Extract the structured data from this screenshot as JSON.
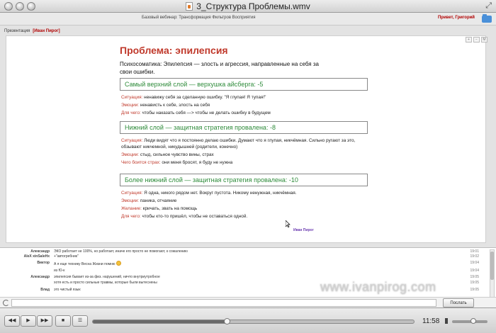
{
  "window": {
    "title": "3_Структура Проблемы.wmv",
    "resize_glyph": "⤢"
  },
  "webinar": {
    "title": "Базовый вебинар: Трансформация Фильтров Восприятия",
    "greeting": "Привет, Григорий"
  },
  "presentation": {
    "label": "Презентация",
    "presenter": "[Иван Пирог]",
    "zoom_buttons": [
      "+",
      "−",
      "M"
    ]
  },
  "slide": {
    "title": "Проблема: эпилепсия",
    "intro": "Психосоматика: Эпилепсия — злость и агрессия, направленные на себя за свои ошибки.",
    "sections": [
      {
        "heading": "Самый верхний слой — верхушка айсберга: -5",
        "lines": [
          {
            "label": "Ситуация:",
            "text": " ненавижу себя за сделанную ошибку. \"Я глупая! Я тупая!\""
          },
          {
            "label": "Эмоции:",
            "text": " ненависть к себе, злость на себя"
          },
          {
            "label": "Для чего:",
            "text": " чтобы наказать себя —> чтобы не делать ошибку в будущем"
          }
        ]
      },
      {
        "heading": "Нижний слой — защитная стратегия провалена: -8",
        "lines": [
          {
            "label": "Ситуация:",
            "text": " Люди видят что я постоянно делаю ошибки. Думают что я глупая, никчёмная. Сильно ругают за это, обзывают никчемной, никудышней (родители, конечно)"
          },
          {
            "label": "Эмоции:",
            "text": " стыд, сильное чувство вины, страх"
          },
          {
            "label": "Чего боится страх:",
            "text": " они меня бросят, я буду не нужна"
          }
        ]
      },
      {
        "heading": "Более нижний слой — защитная стратегия провалена: -10",
        "lines": [
          {
            "label": "Ситуация:",
            "text": " Я одна, никого рядом нет. Вокруг пустота. Никому ненужная, никчёмная."
          },
          {
            "label": "Эмоции:",
            "text": " паника, отчаяние"
          },
          {
            "label": "Желание:",
            "text": " кричать, звать на помощь"
          },
          {
            "label": "Для чего:",
            "text": " чтобы кто-то пришёл, чтобы не оставаться одной."
          }
        ]
      }
    ],
    "signature": "Иван Пирог"
  },
  "chat": {
    "messages": [
      {
        "name": "Александр",
        "text": "ЭКО работает не 100%, но работает, иначе его просто не помогают, к сожалению",
        "time": "19:01"
      },
      {
        "name": "AleX xinSaleHx",
        "text": "+\"автогребник\"",
        "time": "19:02"
      },
      {
        "name": "Виктор",
        "text": "А я еще технику Весна Жизни помню",
        "time": "19:04"
      },
      {
        "name": "",
        "text": "из Ю-к",
        "time": "19:04"
      },
      {
        "name": "Александр",
        "text": "эпилепсия бывает из-за физ. нарушений, ничто внутриутробное",
        "time": "19:05"
      },
      {
        "name": "",
        "text": "хотя есть и просто сильные травмы, которые были вытеснены",
        "time": "19:05"
      },
      {
        "name": "Влад",
        "text": "это чистый язык",
        "time": "19:05"
      }
    ],
    "input_placeholder": "",
    "send_label": "Послать"
  },
  "watermark": "www.ivanpirog.com",
  "player": {
    "buttons": [
      "◀◀",
      "▶",
      "▶▶",
      "■",
      "☰"
    ],
    "time": "11:58",
    "progress": 0.42,
    "volume": 0.6
  }
}
